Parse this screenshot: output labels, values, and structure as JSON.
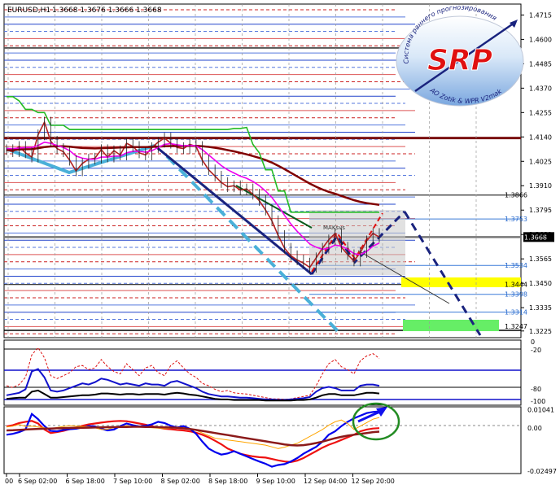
{
  "header": {
    "symbol": "EURUSD,H1",
    "ohlc": "1.3668 1.3676 1.3666 1.3668"
  },
  "logo": {
    "text": "SRP",
    "arc_top": "Система раннего прогнозирования",
    "arc_bottom": "AO Zotik & WPR V2mak"
  },
  "chart_data": [
    {
      "type": "line",
      "title": "",
      "subtitle": "EURUSD,H1",
      "ylabel": "",
      "ylim": [
        1.3205,
        1.4755
      ],
      "y_ticks": [
        "1.4715",
        "1.4600",
        "1.4485",
        "1.4370",
        "1.4255",
        "1.4140",
        "1.4025",
        "1.3910",
        "1.3795",
        "1.3680",
        "1.3565",
        "1.3450",
        "1.3335",
        "1.3225"
      ],
      "price_labels": [
        {
          "text": "1.3866",
          "value": 1.3866,
          "style": "dark"
        },
        {
          "text": "1.3753",
          "value": 1.3753,
          "style": "blue"
        },
        {
          "text": "1.3668",
          "value": 1.3668,
          "style": "current"
        },
        {
          "text": "1.3534",
          "value": 1.3534,
          "style": "blue"
        },
        {
          "text": "1.3444",
          "value": 1.3444,
          "style": "yellow"
        },
        {
          "text": "1.3398",
          "value": 1.3398,
          "style": "blue"
        },
        {
          "text": "1.3314",
          "value": 1.3314,
          "style": "blue"
        },
        {
          "text": "1.3247",
          "value": 1.3247,
          "style": "green"
        }
      ],
      "annotation": "MAKsvs",
      "series": [
        {
          "values": [
            1.408,
            1.407,
            1.4095,
            1.4065,
            1.4045,
            1.415,
            1.421,
            1.412,
            1.4085,
            1.407,
            1.403,
            1.398,
            1.4015,
            1.4035,
            1.404,
            1.408,
            1.4045,
            1.4075,
            1.4055,
            1.411,
            1.4095,
            1.4065,
            1.4055,
            1.409,
            1.4115,
            1.4135,
            1.411,
            1.409,
            1.4085,
            1.4105,
            1.4095,
            1.403,
            1.3985,
            1.3955,
            1.3925,
            1.3905,
            1.391,
            1.389,
            1.3895,
            1.387,
            1.384,
            1.3795,
            1.3745,
            1.3675,
            1.3615,
            1.358,
            1.356,
            1.3545,
            1.3525,
            1.357,
            1.3615,
            1.3655,
            1.3685,
            1.362,
            1.3585,
            1.3555,
            1.3595,
            1.365,
            1.3685,
            1.3668
          ],
          "color": "#b22222"
        },
        {
          "values": [
            1.4078,
            1.4079,
            1.4081,
            1.4082,
            1.4083,
            1.4087,
            1.4092,
            1.4095,
            1.4096,
            1.4096,
            1.4094,
            1.4091,
            1.4088,
            1.4087,
            1.4086,
            1.4087,
            1.4088,
            1.4089,
            1.409,
            1.4091,
            1.4092,
            1.4092,
            1.4092,
            1.4093,
            1.4094,
            1.4096,
            1.4097,
            1.4097,
            1.4097,
            1.4098,
            1.4098,
            1.4096,
            1.4093,
            1.4089,
            1.4084,
            1.4078,
            1.4072,
            1.4065,
            1.4058,
            1.405,
            1.4041,
            1.4031,
            1.4019,
            1.4004,
            1.3988,
            1.3971,
            1.3954,
            1.3937,
            1.392,
            1.3905,
            1.3892,
            1.3881,
            1.3872,
            1.3862,
            1.3852,
            1.3842,
            1.3834,
            1.3828,
            1.3824,
            1.382
          ],
          "color": "#800000"
        },
        {
          "values": [
            1.433,
            1.433,
            1.431,
            1.427,
            1.427,
            1.4255,
            1.4255,
            1.4195,
            1.4195,
            1.4195,
            1.4175,
            1.4175,
            1.4175,
            1.4175,
            1.4175,
            1.4175,
            1.4175,
            1.4175,
            1.4175,
            1.4175,
            1.4175,
            1.4175,
            1.4175,
            1.4175,
            1.4175,
            1.4175,
            1.4175,
            1.4175,
            1.4175,
            1.4175,
            1.4175,
            1.4175,
            1.4175,
            1.4175,
            1.4175,
            1.4175,
            1.418,
            1.418,
            1.4185,
            1.4105,
            1.4065,
            1.3985,
            1.3985,
            1.3885,
            1.3885,
            1.3785,
            1.3785,
            1.3785,
            1.3785,
            1.3785,
            1.3785,
            1.3785,
            1.3785,
            1.3785,
            1.3785,
            1.3785,
            1.3785,
            1.3785,
            1.3785,
            1.3785
          ],
          "color": "#22bb22"
        },
        {
          "values": [
            1.4085,
            1.4085,
            1.4088,
            1.409,
            1.409,
            1.41,
            1.4115,
            1.411,
            1.41,
            1.409,
            1.4075,
            1.405,
            1.404,
            1.4035,
            1.4035,
            1.4045,
            1.4045,
            1.405,
            1.405,
            1.4065,
            1.4072,
            1.4072,
            1.4068,
            1.4075,
            1.409,
            1.4105,
            1.4108,
            1.4103,
            1.4098,
            1.41,
            1.4098,
            1.408,
            1.4055,
            1.403,
            1.4005,
            1.3985,
            1.397,
            1.3955,
            1.3945,
            1.393,
            1.391,
            1.3885,
            1.3855,
            1.3815,
            1.377,
            1.373,
            1.3695,
            1.3665,
            1.3635,
            1.362,
            1.361,
            1.3615,
            1.363,
            1.3625,
            1.361,
            1.359,
            1.3585,
            1.36,
            1.3625,
            1.364
          ],
          "color": "#ee00ee"
        }
      ]
    },
    {
      "type": "line",
      "title": "",
      "ylim": [
        -2,
        102
      ],
      "y_ticks": [
        "0",
        "-20",
        "-80",
        "-100"
      ],
      "series": [
        {
          "values": [
            28,
            25,
            30,
            42,
            80,
            92,
            75,
            45,
            40,
            45,
            50,
            60,
            62,
            55,
            58,
            72,
            60,
            52,
            48,
            65,
            55,
            45,
            58,
            62,
            50,
            45,
            62,
            70,
            58,
            48,
            42,
            32,
            28,
            22,
            18,
            20,
            16,
            15,
            14,
            12,
            10,
            8,
            6,
            6,
            5,
            6,
            8,
            10,
            12,
            28,
            48,
            65,
            72,
            60,
            55,
            48,
            70,
            78,
            82,
            74
          ],
          "color": "#dd1111"
        },
        {
          "values": [
            12,
            14,
            16,
            22,
            52,
            56,
            42,
            20,
            18,
            20,
            24,
            28,
            32,
            30,
            34,
            40,
            38,
            34,
            30,
            32,
            30,
            28,
            32,
            30,
            30,
            28,
            34,
            36,
            32,
            28,
            24,
            18,
            14,
            12,
            10,
            10,
            9,
            8,
            8,
            7,
            6,
            5,
            5,
            4,
            4,
            5,
            6,
            7,
            9,
            18,
            24,
            26,
            24,
            20,
            20,
            20,
            28,
            30,
            30,
            28
          ],
          "color": "#1111cc"
        },
        {
          "values": [
            6,
            7,
            8,
            8,
            18,
            20,
            14,
            8,
            8,
            9,
            10,
            11,
            12,
            12,
            13,
            15,
            15,
            14,
            13,
            14,
            14,
            13,
            14,
            14,
            14,
            13,
            15,
            16,
            15,
            13,
            12,
            10,
            8,
            6,
            5,
            5,
            4,
            4,
            4,
            4,
            4,
            3,
            3,
            3,
            3,
            3,
            4,
            4,
            5,
            8,
            12,
            14,
            14,
            12,
            12,
            12,
            14,
            16,
            16,
            15
          ],
          "color": "#000000"
        }
      ]
    },
    {
      "type": "line",
      "title": "",
      "ylim": [
        -0.0255,
        0.0112
      ],
      "y_ticks": [
        "0.01041",
        "0.00",
        "-0.02497"
      ],
      "series": [
        {
          "values": [
            0.0008,
            0.0015,
            0.0028,
            0.0035,
            0.004,
            0.0025,
            -0.001,
            -0.003,
            -0.0025,
            -0.0018,
            -0.0008,
            0.0002,
            0.0012,
            0.002,
            0.0025,
            0.003,
            0.0035,
            0.0038,
            0.004,
            0.0038,
            0.0032,
            0.0025,
            0.0018,
            0.001,
            0.0002,
            -0.0005,
            -0.0008,
            -0.0012,
            -0.0015,
            -0.002,
            -0.0028,
            -0.004,
            -0.0055,
            -0.0075,
            -0.0095,
            -0.012,
            -0.0135,
            -0.015,
            -0.0158,
            -0.0165,
            -0.017,
            -0.0172,
            -0.018,
            -0.0188,
            -0.0195,
            -0.0198,
            -0.019,
            -0.0175,
            -0.0155,
            -0.0135,
            -0.0115,
            -0.0098,
            -0.0085,
            -0.007,
            -0.0055,
            -0.004,
            -0.002,
            -0.001,
            -0.0004,
            -0.0002
          ],
          "color": "#ee1111"
        },
        {
          "values": [
            -0.004,
            -0.0035,
            -0.0025,
            -0.001,
            0.008,
            0.005,
            0.001,
            -0.0018,
            -0.002,
            -0.0012,
            -0.0008,
            -0.0005,
            0.0002,
            0.001,
            0.0008,
            -0.0005,
            -0.0015,
            -0.001,
            0.001,
            0.0025,
            0.0015,
            0.0008,
            0.0012,
            0.002,
            0.0035,
            0.0028,
            0.0012,
            0.0002,
            0.001,
            -0.0005,
            -0.0035,
            -0.008,
            -0.012,
            -0.014,
            -0.0155,
            -0.0148,
            -0.0135,
            -0.015,
            -0.0165,
            -0.018,
            -0.0195,
            -0.0208,
            -0.0225,
            -0.0215,
            -0.021,
            -0.0195,
            -0.0175,
            -0.015,
            -0.013,
            -0.011,
            -0.008,
            -0.004,
            -0.002,
            0.001,
            0.0035,
            0.0055,
            0.007,
            0.0085,
            0.0092,
            0.0095
          ],
          "color": "#0000ee"
        },
        {
          "values": [
            0.0005,
            0.001,
            0.002,
            0.0008,
            0.001,
            0.0005,
            0.0,
            -0.0005,
            0.0002,
            0.0008,
            0.0012,
            0.001,
            0.0008,
            0.0006,
            0.0,
            -0.001,
            -0.0008,
            0.0002,
            0.0008,
            0.0012,
            0.0008,
            0.0005,
            0.0003,
            0.0,
            -0.0002,
            -0.0005,
            -0.0002,
            0.0003,
            0.0001,
            -0.0005,
            -0.0015,
            -0.003,
            -0.0045,
            -0.006,
            -0.0065,
            -0.007,
            -0.0075,
            -0.008,
            -0.0085,
            -0.009,
            -0.0095,
            -0.01,
            -0.011,
            -0.012,
            -0.0112,
            -0.01,
            -0.009,
            -0.007,
            -0.005,
            -0.003,
            -0.001,
            0.0015,
            0.0035,
            0.0045,
            0.0025,
            -0.001,
            0.001,
            0.003,
            0.005,
            0.006
          ],
          "color": "#ffa500"
        },
        {
          "values": [
            -0.0015,
            -0.0014,
            -0.0012,
            -0.001,
            -0.0008,
            -0.0006,
            -0.0005,
            -0.0004,
            -0.0003,
            -0.0002,
            -0.0001,
            0.0,
            0.0,
            0.0001,
            0.0002,
            0.0003,
            0.0004,
            0.0004,
            0.0005,
            0.0005,
            0.0006,
            0.0006,
            0.0005,
            0.0005,
            0.0004,
            0.0003,
            0.0002,
            0.0,
            -0.0003,
            -0.0007,
            -0.0012,
            -0.0018,
            -0.0024,
            -0.003,
            -0.0036,
            -0.0042,
            -0.0048,
            -0.0054,
            -0.006,
            -0.0066,
            -0.0072,
            -0.0078,
            -0.0084,
            -0.009,
            -0.0096,
            -0.01,
            -0.0102,
            -0.01,
            -0.0095,
            -0.0088,
            -0.008,
            -0.007,
            -0.006,
            -0.0052,
            -0.0045,
            -0.004,
            -0.0035,
            -0.003,
            -0.0025,
            -0.0022
          ],
          "color": "#8b1a1a"
        }
      ]
    }
  ],
  "x_axis": {
    "ticks": [
      "00",
      "6 Sep 02:00",
      "6 Sep 18:00",
      "7 Sep 10:00",
      "8 Sep 02:00",
      "8 Sep 18:00",
      "9 Sep 10:00",
      "12 Sep 04:00",
      "12 Sep 20:00"
    ]
  }
}
